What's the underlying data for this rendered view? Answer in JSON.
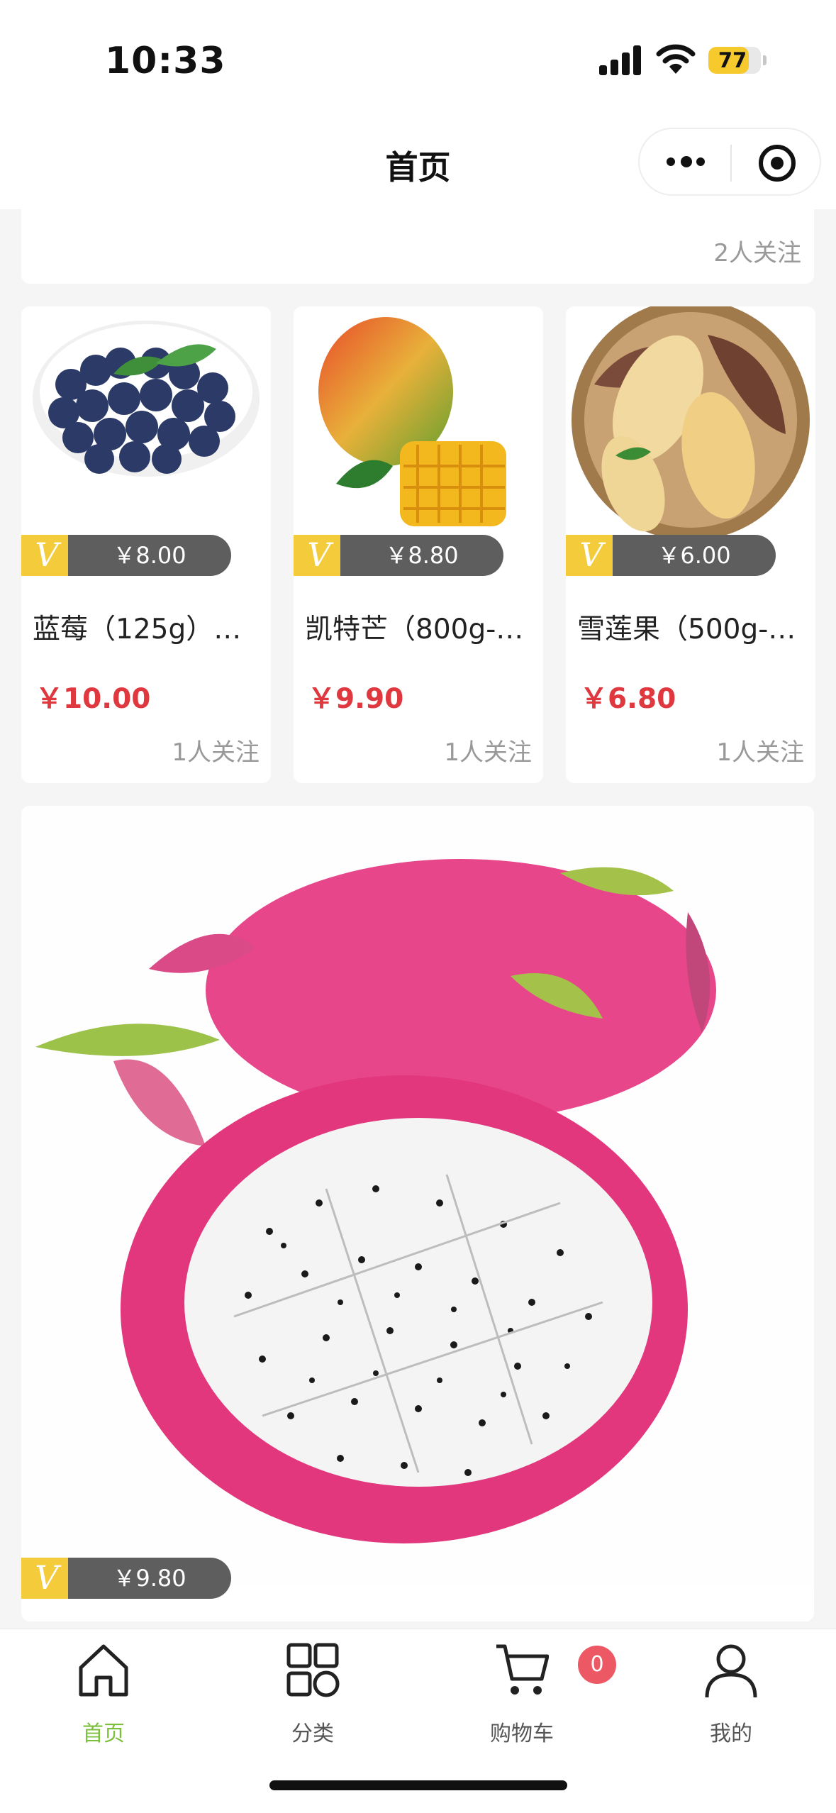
{
  "status_bar": {
    "time": "10:33",
    "battery": "77",
    "battery_level": 0.77,
    "icons": [
      "cellular-signal-icon",
      "wifi-icon",
      "battery-icon"
    ]
  },
  "nav": {
    "title": "首页",
    "capsule_icons": [
      "more-icon",
      "close-miniprogram-icon"
    ]
  },
  "top_card": {
    "follow": "2人关注"
  },
  "products": [
    {
      "name": "蓝莓（125g）…",
      "vip_price": "￥8.00",
      "price": "￥10.00",
      "follow": "1人关注",
      "image": "blueberry-image"
    },
    {
      "name": "凯特芒（800g-…",
      "vip_price": "￥8.80",
      "price": "￥9.90",
      "follow": "1人关注",
      "image": "mango-image"
    },
    {
      "name": "雪莲果（500g-…",
      "vip_price": "￥6.00",
      "price": "￥6.80",
      "follow": "1人关注",
      "image": "yacon-image"
    }
  ],
  "featured": {
    "vip_price": "￥9.80",
    "image": "dragon-fruit-image"
  },
  "vip_mark": "V",
  "colors": {
    "accent_green": "#7bbf3b",
    "price_red": "#e0383f",
    "vip_yellow": "#f4cc3b",
    "badge_red": "#ec5964"
  },
  "tabbar": {
    "tabs": [
      {
        "label": "首页",
        "icon": "home-icon",
        "active": true
      },
      {
        "label": "分类",
        "icon": "category-icon",
        "active": false
      },
      {
        "label": "购物车",
        "icon": "cart-icon",
        "active": false
      },
      {
        "label": "我的",
        "icon": "profile-icon",
        "active": false
      }
    ],
    "cart_badge": "0"
  }
}
